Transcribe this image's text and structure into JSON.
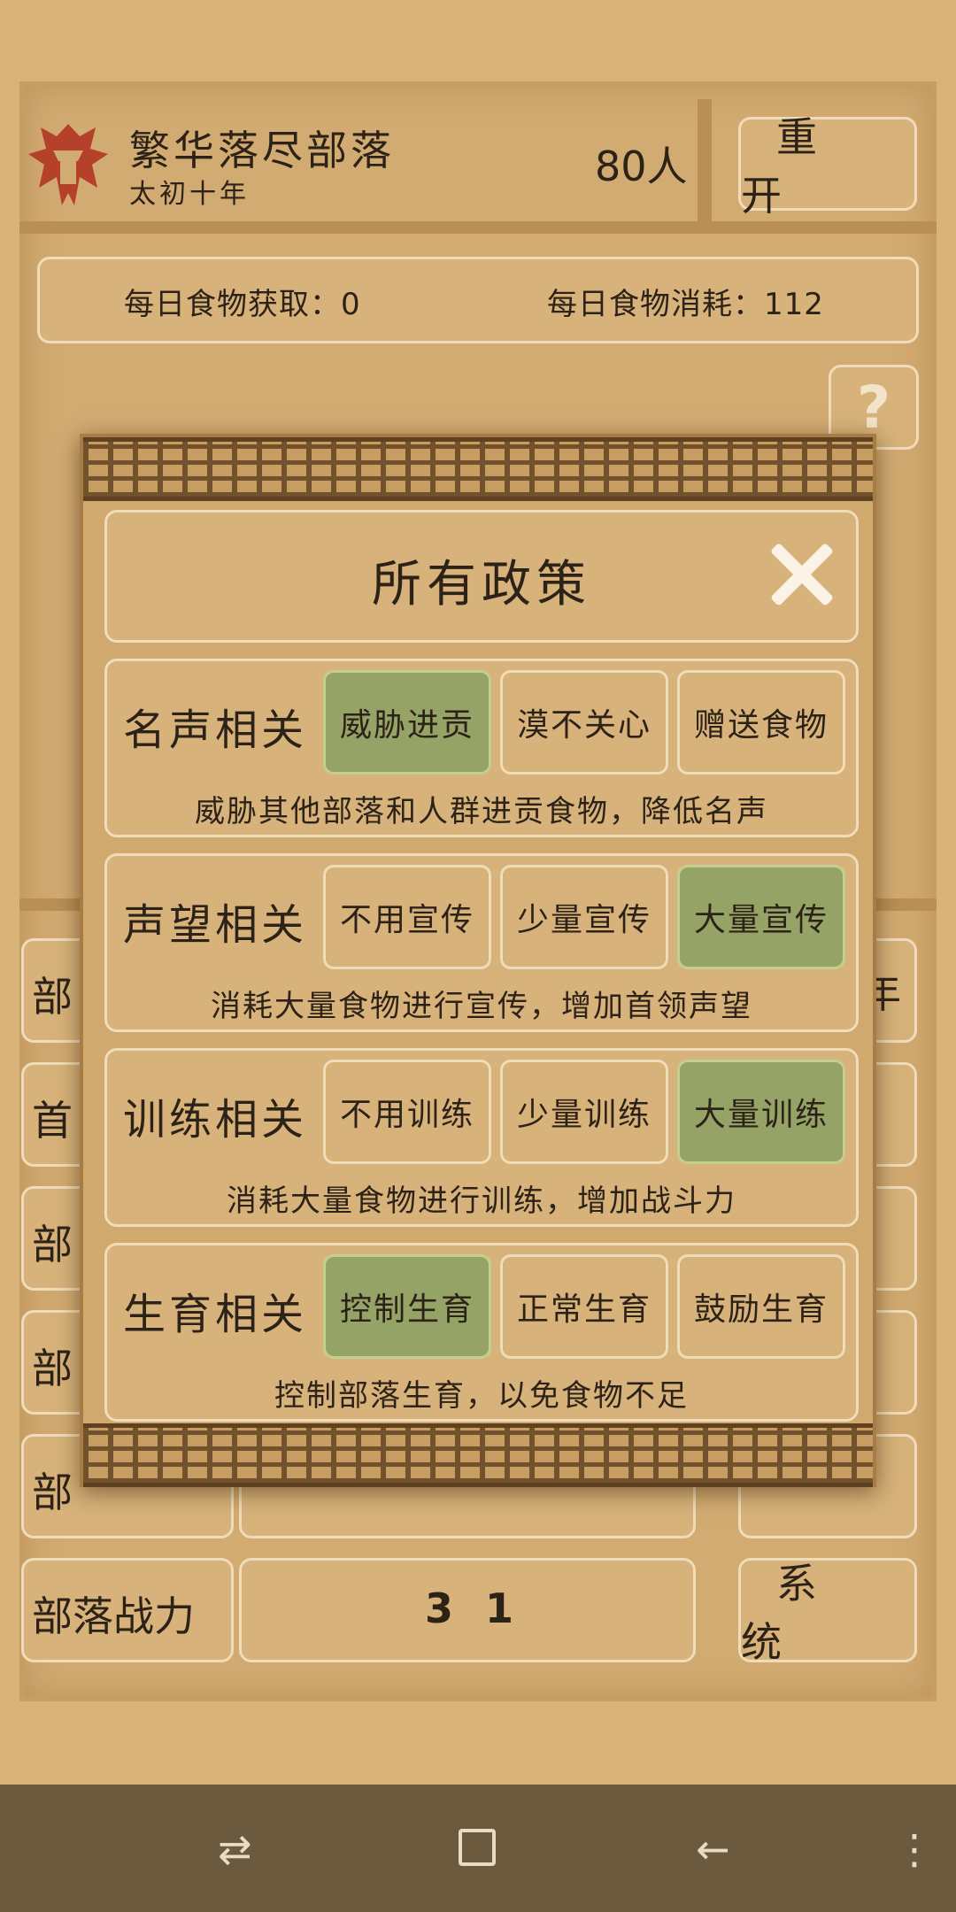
{
  "header": {
    "tribe_name": "繁华落尽部落",
    "year": "太初十年",
    "population": "80人",
    "restart_label": "重 开"
  },
  "food": {
    "daily_gain_label": "每日食物获取：0",
    "daily_cost_label": "每日食物消耗：112"
  },
  "help": {
    "label": "?"
  },
  "background_rows": [
    {
      "label": "部",
      "value": "",
      "side": "年"
    },
    {
      "label": "首",
      "value": "",
      "side": ""
    },
    {
      "label": "部",
      "value": "",
      "side": ""
    },
    {
      "label": "部",
      "value": "",
      "side": ""
    },
    {
      "label": "部",
      "value": "",
      "side": ""
    },
    {
      "label": "部落战力",
      "value": "3 1",
      "side": "系 统"
    }
  ],
  "modal": {
    "title": "所有政策",
    "policies": [
      {
        "category": "名声相关",
        "options": [
          "威胁进贡",
          "漠不关心",
          "赠送食物"
        ],
        "selected": 0,
        "description": "威胁其他部落和人群进贡食物，降低名声"
      },
      {
        "category": "声望相关",
        "options": [
          "不用宣传",
          "少量宣传",
          "大量宣传"
        ],
        "selected": 2,
        "description": "消耗大量食物进行宣传，增加首领声望"
      },
      {
        "category": "训练相关",
        "options": [
          "不用训练",
          "少量训练",
          "大量训练"
        ],
        "selected": 2,
        "description": "消耗大量食物进行训练，增加战斗力"
      },
      {
        "category": "生育相关",
        "options": [
          "控制生育",
          "正常生育",
          "鼓励生育"
        ],
        "selected": 0,
        "description": "控制部落生育，以免食物不足"
      }
    ]
  },
  "colors": {
    "selected_option": "#95a367",
    "emblem": "#b5412a",
    "parchment": "#d2ab72"
  },
  "navbar": {
    "icons": [
      "recent-apps-icon",
      "home-icon",
      "back-icon",
      "menu-icon"
    ]
  }
}
